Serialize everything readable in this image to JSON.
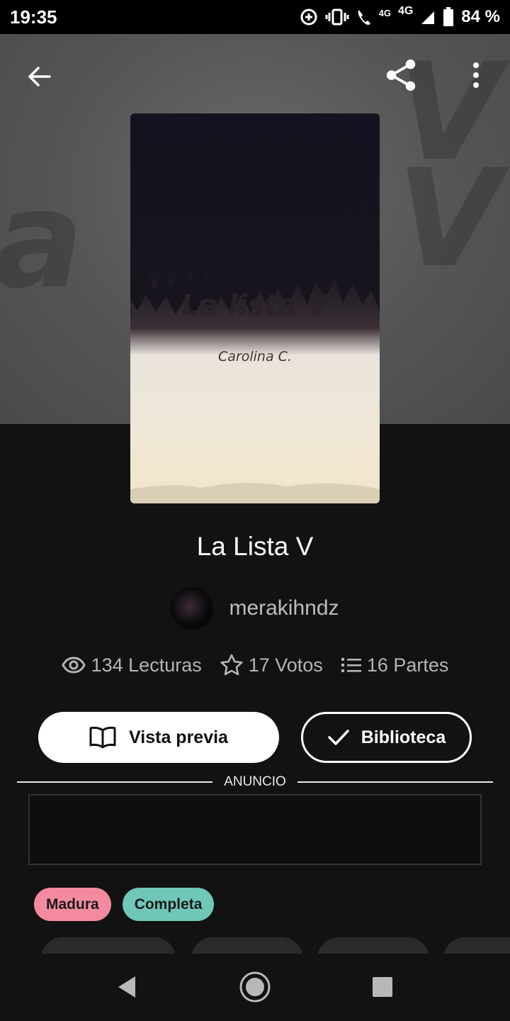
{
  "status_bar": {
    "time": "19:35",
    "network_small": "4G",
    "network": "4G",
    "battery": "84 %"
  },
  "toolbar": {
    "back_icon": "arrow-left-icon",
    "share_icon": "share-icon",
    "more_icon": "more-vertical-icon"
  },
  "cover": {
    "title": "La lista V",
    "author": "Carolina C."
  },
  "book": {
    "title": "La Lista V",
    "author": "merakihndz"
  },
  "stats": {
    "reads": "134 Lecturas",
    "votes": "17 Votos",
    "parts": "16 Partes"
  },
  "actions": {
    "preview_label": "Vista previa",
    "library_label": "Biblioteca"
  },
  "ad": {
    "label": "ANUNCIO"
  },
  "tags": [
    {
      "label": "Madura",
      "color": "#f48aa0"
    },
    {
      "label": "Completa",
      "color": "#6fc7b8"
    }
  ]
}
